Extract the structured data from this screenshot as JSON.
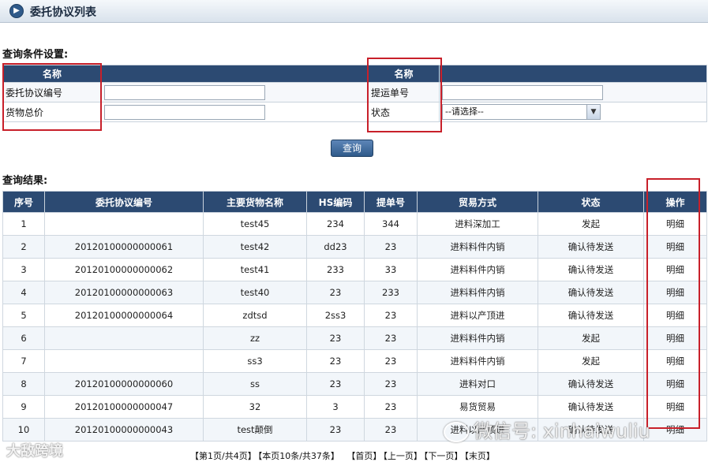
{
  "title": "委托协议列表",
  "query_section_label": "查询条件设置:",
  "results_section_label": "查询结果:",
  "query": {
    "left_header": "名称",
    "right_header": "名称",
    "fields": [
      {
        "label": "委托协议编号",
        "value": ""
      },
      {
        "label": "货物总价",
        "value": ""
      },
      {
        "label": "提运单号",
        "value": ""
      },
      {
        "label": "状态",
        "value": "--请选择--"
      }
    ],
    "button": "查询"
  },
  "results": {
    "headers": [
      "序号",
      "委托协议编号",
      "主要货物名称",
      "HS编码",
      "提单号",
      "贸易方式",
      "状态",
      "操作"
    ],
    "rows": [
      [
        "1",
        "",
        "test45",
        "234",
        "344",
        "进料深加工",
        "发起",
        "明细"
      ],
      [
        "2",
        "20120100000000061",
        "test42",
        "dd23",
        "23",
        "进料料件内销",
        "确认待发送",
        "明细"
      ],
      [
        "3",
        "20120100000000062",
        "test41",
        "233",
        "33",
        "进料料件内销",
        "确认待发送",
        "明细"
      ],
      [
        "4",
        "20120100000000063",
        "test40",
        "23",
        "233",
        "进料料件内销",
        "确认待发送",
        "明细"
      ],
      [
        "5",
        "20120100000000064",
        "zdtsd",
        "2ss3",
        "23",
        "进料以产顶进",
        "确认待发送",
        "明细"
      ],
      [
        "6",
        "",
        "zz",
        "23",
        "23",
        "进料料件内销",
        "发起",
        "明细"
      ],
      [
        "7",
        "",
        "ss3",
        "23",
        "23",
        "进料料件内销",
        "发起",
        "明细"
      ],
      [
        "8",
        "20120100000000060",
        "ss",
        "23",
        "23",
        "进料对口",
        "确认待发送",
        "明细"
      ],
      [
        "9",
        "20120100000000047",
        "32",
        "3",
        "23",
        "易货贸易",
        "确认待发送",
        "明细"
      ],
      [
        "10",
        "20120100000000043",
        "test颠倒",
        "23",
        "23",
        "进料以产顶进",
        "确认待发送",
        "明细"
      ]
    ]
  },
  "pager": {
    "page_info": "【第1页/共4页】",
    "count_info": "【本页10条/共37条】",
    "first": "【首页】",
    "prev": "【上一页】",
    "next": "【下一页】",
    "last": "【末页】"
  },
  "watermarks": {
    "left": "大敌跨境",
    "right": "微信号: xinhaiwuliu"
  },
  "colors": {
    "header_bg": "#2c4a72",
    "highlight": "#c8202a"
  }
}
